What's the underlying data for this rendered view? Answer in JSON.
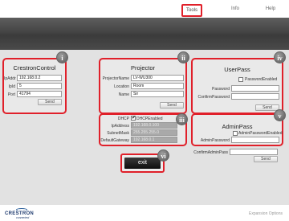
{
  "nav": {
    "tabs": [
      {
        "label": "Tools",
        "active": true
      },
      {
        "label": "Info",
        "active": false
      },
      {
        "label": "Help",
        "active": false
      }
    ]
  },
  "crestron": {
    "title": "CrestronControl",
    "badge": "i",
    "ip_label": "IpAddr",
    "ip_value": "192.168.0.2",
    "ipid_label": "IpId",
    "ipid_value": "5",
    "port_label": "Port",
    "port_value": "41794",
    "send_label": "Send"
  },
  "projector": {
    "title": "Projector",
    "badge": "ii",
    "name_label": "ProjectorName",
    "name_value": "LV-WU300",
    "location_label": "Location",
    "location_value": "Room",
    "contact_label": "Name",
    "contact_value": "Sir",
    "send_label": "Send"
  },
  "userpass": {
    "title": "UserPass",
    "badge": "iv",
    "enabled_label": "PasswordEnabled",
    "password_label": "Password",
    "confirm_label": "ConfirmPassword",
    "send_label": "Send"
  },
  "network": {
    "badge": "iii",
    "dhcp_label": "DHCP",
    "dhcp_checkbox_label": "DHCPEnabled",
    "ip_label": "IpAddress",
    "ip_value": "192.168.0.100",
    "subnet_label": "SubnetMask",
    "subnet_value": "255.255.255.0",
    "gateway_label": "DefaultGateway",
    "gateway_value": "192.168.0.1",
    "send_label": "Send"
  },
  "adminpass": {
    "title": "AdminPass",
    "badge": "v",
    "enabled_label": "AdminPasswordEnabled",
    "password_label": "AdminPassword",
    "confirm_label": "ConfirmAdminPass",
    "send_label": "Send"
  },
  "exit": {
    "label": "exit",
    "badge": "vi"
  },
  "footer": {
    "logo_text": "CRESTRON",
    "logo_sub": "connected",
    "link": "Expansion Options"
  },
  "colors": {
    "highlight": "#e0202a",
    "banner": "#4a4a4a",
    "panel_bg": "#e9e9e9"
  }
}
